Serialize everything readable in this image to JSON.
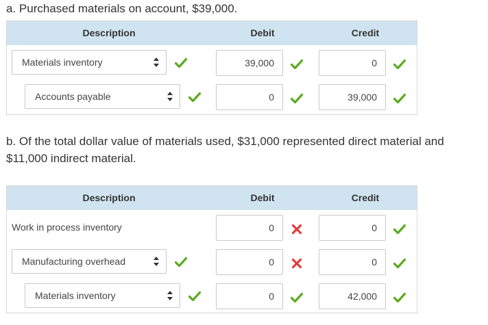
{
  "prompts": {
    "a": "a. Purchased materials on account, $39,000.",
    "b": "b. Of the total dollar value of materials used, $31,000 represented direct material and $11,000 indirect material."
  },
  "headers": {
    "description": "Description",
    "debit": "Debit",
    "credit": "Credit"
  },
  "colors": {
    "check": "#5aaa1f",
    "cross": "#e33b3b",
    "header_bg": "#cfe4f0"
  },
  "entry_a": {
    "rows": [
      {
        "account": "Materials inventory",
        "debit": "39,000",
        "credit": "0",
        "account_status": "check-icon",
        "debit_status": "check-icon",
        "credit_status": "check-icon"
      },
      {
        "account": "Accounts payable",
        "debit": "0",
        "credit": "39,000",
        "account_status": "check-icon",
        "debit_status": "check-icon",
        "credit_status": "check-icon"
      }
    ]
  },
  "entry_b": {
    "rows": [
      {
        "account": "Work in process inventory",
        "debit": "0",
        "credit": "0",
        "debit_status": "cross-icon",
        "credit_status": "check-icon"
      },
      {
        "account": "Manufacturing overhead",
        "debit": "0",
        "credit": "0",
        "account_status": "check-icon",
        "debit_status": "cross-icon",
        "credit_status": "check-icon"
      },
      {
        "account": "Materials inventory",
        "debit": "0",
        "credit": "42,000",
        "account_status": "check-icon",
        "debit_status": "check-icon",
        "credit_status": "check-icon"
      }
    ]
  }
}
